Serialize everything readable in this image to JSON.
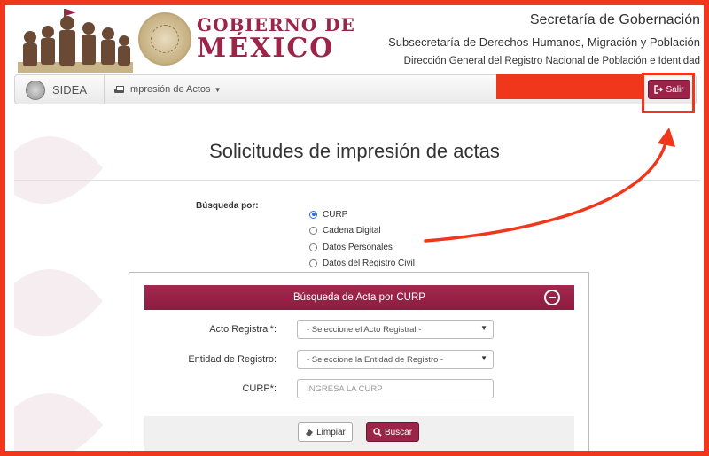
{
  "header": {
    "brand_line1": "GOBIERNO DE",
    "brand_line2": "MÉXICO",
    "secretaria": "Secretaría de Gobernación",
    "subsecretaria": "Subsecretaría de Derechos Humanos, Migración y Población",
    "direccion": "Dirección General del Registro Nacional de Población e Identidad"
  },
  "navbar": {
    "brand": "SIDEA",
    "menu_label": "Impresión de Actos",
    "logout_label": "Salir"
  },
  "page": {
    "title": "Solicitudes de impresión de actas"
  },
  "search": {
    "label": "Búsqueda por:",
    "options": [
      "CURP",
      "Cadena Digital",
      "Datos Personales",
      "Datos del Registro Civil"
    ],
    "selected": "CURP"
  },
  "panel": {
    "title": "Búsqueda de Acta por CURP",
    "acto_label": "Acto Registral*:",
    "acto_value": "- Seleccione el Acto Registral -",
    "entidad_label": "Entidad de Registro:",
    "entidad_value": "- Seleccione la Entidad de Registro -",
    "curp_label": "CURP*:",
    "curp_placeholder": "INGRESA LA CURP",
    "clear_label": "Limpiar",
    "search_label": "Buscar"
  },
  "colors": {
    "brand": "#9d2449",
    "annotation": "#f0361b"
  }
}
